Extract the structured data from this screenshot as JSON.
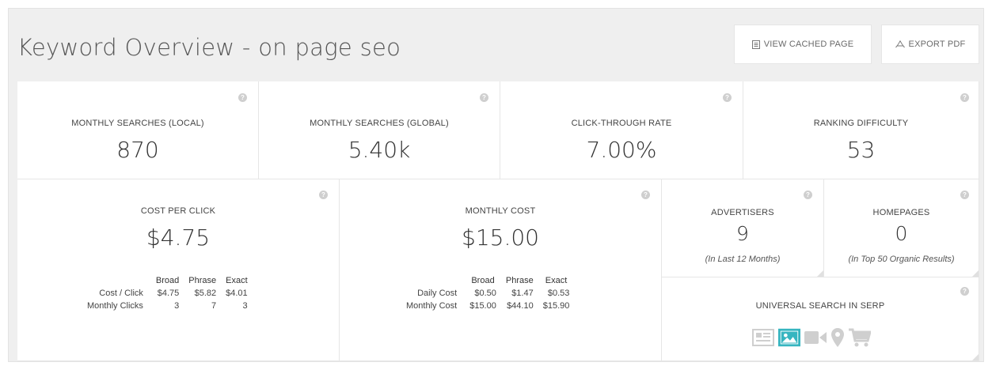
{
  "header": {
    "title": "Keyword Overview - on page seo",
    "view_cached_label": "VIEW CACHED PAGE",
    "export_pdf_label": "EXPORT PDF"
  },
  "metrics": {
    "local": {
      "label": "MONTHLY SEARCHES (LOCAL)",
      "value": "870"
    },
    "global": {
      "label": "MONTHLY SEARCHES (GLOBAL)",
      "value": "5.40k"
    },
    "ctr": {
      "label": "CLICK-THROUGH RATE",
      "value": "7.00%"
    },
    "difficulty": {
      "label": "RANKING DIFFICULTY",
      "value": "53"
    }
  },
  "cpc": {
    "label": "COST PER CLICK",
    "value": "$4.75",
    "columns": [
      "Broad",
      "Phrase",
      "Exact"
    ],
    "rows": [
      {
        "label": "Cost / Click",
        "values": [
          "$4.75",
          "$5.82",
          "$4.01"
        ]
      },
      {
        "label": "Monthly Clicks",
        "values": [
          "3",
          "7",
          "3"
        ]
      }
    ]
  },
  "monthly_cost": {
    "label": "MONTHLY COST",
    "value": "$15.00",
    "columns": [
      "Broad",
      "Phrase",
      "Exact"
    ],
    "rows": [
      {
        "label": "Daily Cost",
        "values": [
          "$0.50",
          "$1.47",
          "$0.53"
        ]
      },
      {
        "label": "Monthly Cost",
        "values": [
          "$15.00",
          "$44.10",
          "$15.90"
        ]
      }
    ]
  },
  "advertisers": {
    "label": "ADVERTISERS",
    "value": "9",
    "note": "(In Last 12 Months)"
  },
  "homepages": {
    "label": "HOMEPAGES",
    "value": "0",
    "note": "(In Top 50 Organic Results)"
  },
  "universal": {
    "label": "UNIVERSAL SEARCH IN SERP",
    "icons": [
      "news-icon",
      "image-icon",
      "video-icon",
      "map-pin-icon",
      "shopping-cart-icon"
    ],
    "active_icon": "image-icon"
  },
  "colors": {
    "accent": "#36b5c0",
    "muted_icon": "#cfcfcf",
    "help": "#cfcfcf"
  }
}
